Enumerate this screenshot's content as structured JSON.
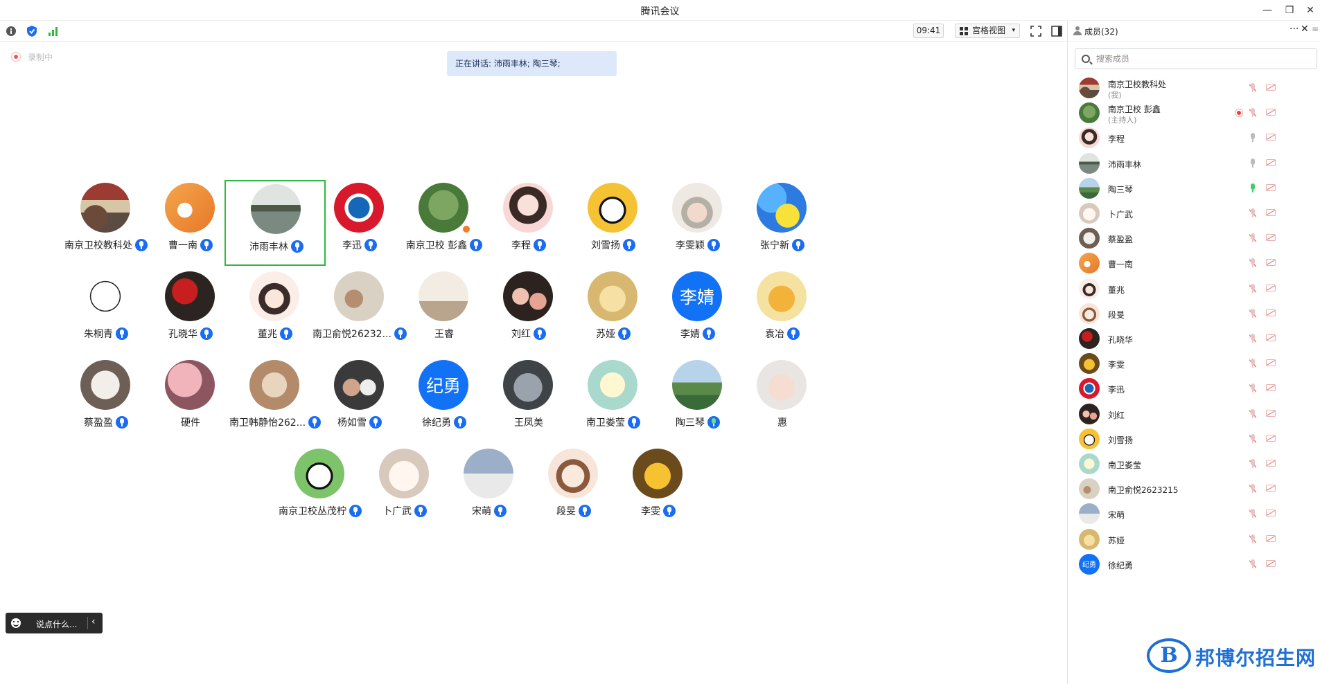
{
  "window": {
    "title": "腾讯会议",
    "minimize_glyph": "—",
    "restore_glyph": "❐",
    "close_glyph": "✕"
  },
  "toolbar": {
    "clock": "09:41",
    "view_label": "宫格视图",
    "caret": "▾"
  },
  "status": {
    "recording_label": "录制中",
    "speaking": "正在讲话: 沛雨丰林; 陶三琴;"
  },
  "grid": {
    "tiles": [
      {
        "name": "南京卫校教科处",
        "mic": "on",
        "avatar": "photo-street"
      },
      {
        "name": "曹一南",
        "mic": "on",
        "avatar": "orange-cartoon"
      },
      {
        "name": "沛雨丰林",
        "mic": "on",
        "avatar": "lake",
        "highlight": true
      },
      {
        "name": "李迅",
        "mic": "on",
        "avatar": "fc-bayern"
      },
      {
        "name": "南京卫校  彭鑫",
        "mic": "on",
        "avatar": "tree",
        "host": true
      },
      {
        "name": "李程",
        "mic": "on",
        "avatar": "girl-drawing"
      },
      {
        "name": "刘雪扬",
        "mic": "on",
        "avatar": "snoopy"
      },
      {
        "name": "李雯颖",
        "mic": "on",
        "avatar": "girl-hat"
      },
      {
        "name": "张宁新",
        "mic": "on",
        "avatar": "smiley-balls"
      },
      {
        "name": "朱桐青",
        "mic": "on",
        "avatar": "rabbit-sketch"
      },
      {
        "name": "孔晓华",
        "mic": "on",
        "avatar": "red-flowers"
      },
      {
        "name": "董兆",
        "mic": "on",
        "avatar": "girl-cartoon"
      },
      {
        "name": "南卫俞悦26232...",
        "mic": "on",
        "avatar": "kid-photo"
      },
      {
        "name": "王睿",
        "mic": "none",
        "avatar": "eiffel"
      },
      {
        "name": "刘红",
        "mic": "on",
        "avatar": "selfie"
      },
      {
        "name": "苏娅",
        "mic": "on",
        "avatar": "bear-yellow"
      },
      {
        "name": "李婧",
        "mic": "on",
        "avatar_text": "李婧"
      },
      {
        "name": "袁冶",
        "mic": "on",
        "avatar": "animal-crossing"
      },
      {
        "name": "蔡盈盈",
        "mic": "on",
        "avatar": "white-dog"
      },
      {
        "name": "硬件",
        "mic": "none",
        "avatar": "pink-tree"
      },
      {
        "name": "南卫韩静怡262...",
        "mic": "on",
        "avatar": "food"
      },
      {
        "name": "杨如雪",
        "mic": "on",
        "avatar": "couple"
      },
      {
        "name": "徐纪勇",
        "mic": "on",
        "avatar_text": "纪勇"
      },
      {
        "name": "王凤美",
        "mic": "none",
        "avatar": "grey-cat"
      },
      {
        "name": "南卫娄莹",
        "mic": "on",
        "avatar": "cat-sticker"
      },
      {
        "name": "陶三琴",
        "mic": "speaking",
        "avatar": "landscape"
      },
      {
        "name": "惠",
        "mic": "none",
        "avatar": "baby"
      },
      {
        "name": "南京卫校丛茂柠",
        "mic": "on",
        "avatar": "panda"
      },
      {
        "name": "卜广武",
        "mic": "on",
        "avatar": "white-cat"
      },
      {
        "name": "宋萌",
        "mic": "on",
        "avatar": "snowmen"
      },
      {
        "name": "段旻",
        "mic": "on",
        "avatar": "cartoon-girl-glasses"
      },
      {
        "name": "李雯",
        "mic": "on",
        "avatar": "chick"
      }
    ]
  },
  "chat": {
    "placeholder": "说点什么...",
    "collapse": "‹"
  },
  "panel": {
    "title": "成员(32)",
    "more": "···",
    "close": "✕",
    "side": "≡",
    "search_placeholder": "搜索成员",
    "members": [
      {
        "name": "南京卫校教科处",
        "sub": "(我)",
        "avatar": "photo-street",
        "mic": "muted"
      },
      {
        "name": "南京卫校  彭鑫",
        "sub": "(主持人)",
        "avatar": "tree",
        "mic": "muted",
        "recording": true
      },
      {
        "name": "李程",
        "avatar": "girl-drawing",
        "mic": "idle"
      },
      {
        "name": "沛雨丰林",
        "avatar": "lake",
        "mic": "idle"
      },
      {
        "name": "陶三琴",
        "avatar": "landscape",
        "mic": "on"
      },
      {
        "name": "卜广武",
        "avatar": "white-cat",
        "mic": "muted"
      },
      {
        "name": "蔡盈盈",
        "avatar": "white-dog",
        "mic": "muted"
      },
      {
        "name": "曹一南",
        "avatar": "orange-cartoon",
        "mic": "muted"
      },
      {
        "name": "董兆",
        "avatar": "girl-cartoon",
        "mic": "muted"
      },
      {
        "name": "段旻",
        "avatar": "cartoon-girl-glasses",
        "mic": "muted"
      },
      {
        "name": "孔晓华",
        "avatar": "red-flowers",
        "mic": "muted"
      },
      {
        "name": "李雯",
        "avatar": "chick",
        "mic": "muted"
      },
      {
        "name": "李迅",
        "avatar": "fc-bayern",
        "mic": "muted"
      },
      {
        "name": "刘红",
        "avatar": "selfie",
        "mic": "muted"
      },
      {
        "name": "刘雪扬",
        "avatar": "snoopy",
        "mic": "muted"
      },
      {
        "name": "南卫娄莹",
        "avatar": "cat-sticker",
        "mic": "muted"
      },
      {
        "name": "南卫俞悦2623215",
        "avatar": "kid-photo",
        "mic": "muted"
      },
      {
        "name": "宋萌",
        "avatar": "snowmen",
        "mic": "muted"
      },
      {
        "name": "苏娅",
        "avatar": "bear-yellow",
        "mic": "muted"
      },
      {
        "name": "徐纪勇",
        "avatar_text": "纪勇",
        "mic": "muted"
      }
    ]
  },
  "watermark": {
    "logo": "B",
    "text": "邦博尔招生网"
  },
  "colors": {
    "accent": "#1a6df2",
    "speaking_border": "#2cba3b",
    "host_badge": "#f57c24",
    "recording": "#f25555"
  }
}
